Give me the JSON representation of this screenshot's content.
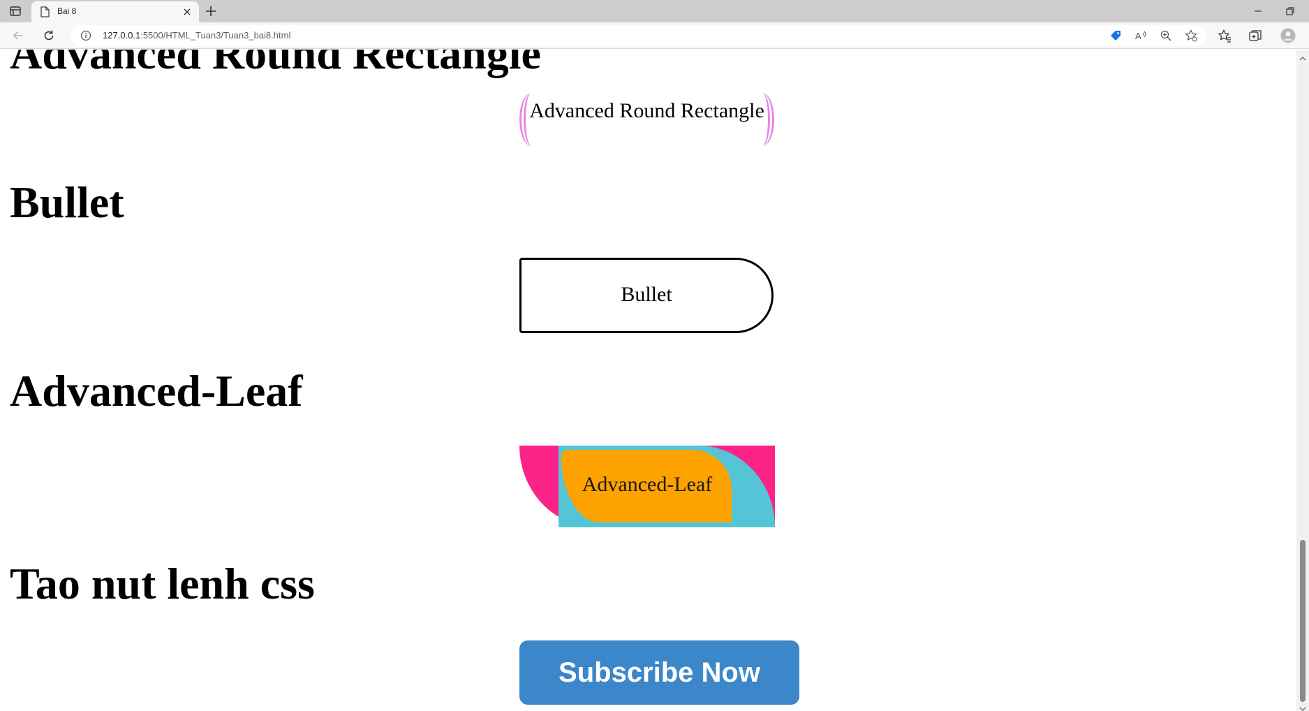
{
  "browser": {
    "tab_title": "Bai 8",
    "url_host": "127.0.0.1",
    "url_path": ":5500/HTML_Tuan3/Tuan3_bai8.html",
    "toolbar_icons": [
      "back-icon",
      "refresh-icon",
      "info-icon",
      "tag-icon",
      "read-aloud-icon",
      "zoom-icon",
      "add-favorite-icon",
      "favorites-icon",
      "collections-icon",
      "profile-icon"
    ]
  },
  "page": {
    "headings": {
      "advanced_round_rectangle": "Advanced Round Rectangle",
      "bullet": "Bullet",
      "advanced_leaf": "Advanced-Leaf",
      "tao_nut": "Tao nut lenh css"
    },
    "shapes": {
      "advanced_round_rectangle_label": "Advanced Round Rectangle",
      "bullet_label": "Bullet",
      "advanced_leaf_label": "Advanced-Leaf"
    },
    "subscribe_button": "Subscribe Now"
  },
  "colors": {
    "round_rect_border": "#e685e3",
    "leaf_pink": "#fc2388",
    "leaf_teal": "#55c4d6",
    "leaf_orange": "#fea200",
    "subscribe_bg": "#3b87c9"
  }
}
